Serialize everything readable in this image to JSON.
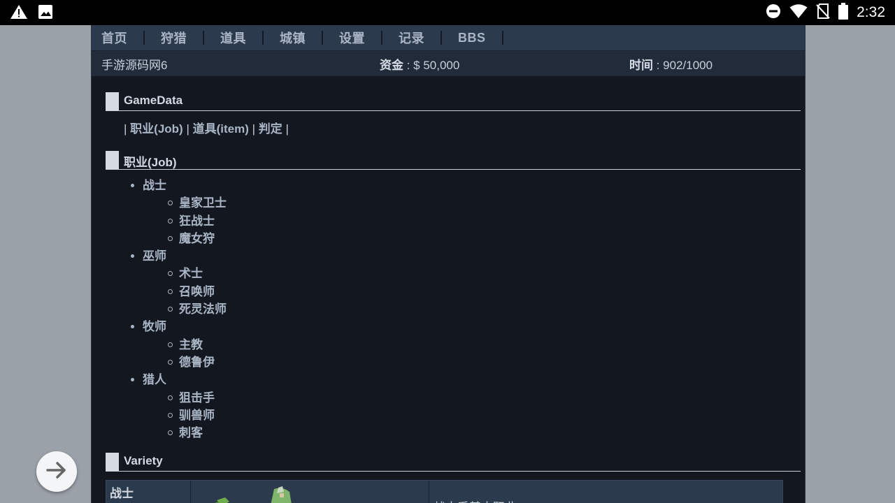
{
  "statusbar": {
    "time": "2:32",
    "icons": [
      "warning-icon",
      "image-icon",
      "dnd-icon",
      "wifi-icon",
      "no-sim-icon",
      "battery-icon"
    ]
  },
  "nav": {
    "items": [
      {
        "label": "首页"
      },
      {
        "label": "狩猎"
      },
      {
        "label": "道具"
      },
      {
        "label": "城镇"
      },
      {
        "label": "设置"
      },
      {
        "label": "记录"
      },
      {
        "label": "BBS"
      }
    ]
  },
  "info": {
    "site": "手游源码网6",
    "money_label": "资金",
    "money_value": " : $ 50,000",
    "time_label": "时间",
    "time_value": " : 902/1000"
  },
  "sections": {
    "gamedata": "GameData",
    "job": "职业(Job)",
    "variety": "Variety"
  },
  "links": {
    "sep": "|",
    "job": "职业(Job)",
    "item": "道具(item)",
    "judge": "判定"
  },
  "jobs": [
    {
      "name": "战士",
      "subs": [
        "皇家卫士",
        "狂战士",
        "魔女狩"
      ]
    },
    {
      "name": "巫师",
      "subs": [
        "术士",
        "召唤师",
        "死灵法师"
      ]
    },
    {
      "name": "牧师",
      "subs": [
        "主教",
        "德鲁伊"
      ]
    },
    {
      "name": "猎人",
      "subs": [
        "狙击手",
        "驯兽师",
        "刺客"
      ]
    }
  ],
  "variety": {
    "name": "战士",
    "desc": "战士系基本职业"
  },
  "colors": {
    "page_bg": "#121720",
    "nav_bg": "#2c3a4d",
    "link": "#aab6c5"
  }
}
